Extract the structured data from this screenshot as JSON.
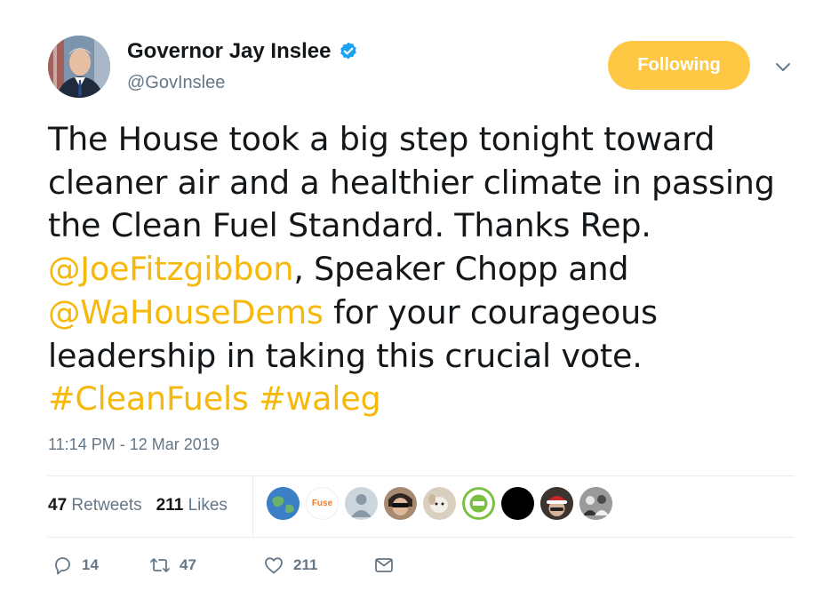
{
  "header": {
    "display_name": "Governor Jay Inslee",
    "handle": "@GovInslee",
    "follow_label": "Following",
    "avatar_icon": "profile-photo-icon",
    "verified_icon": "verified-badge-icon"
  },
  "tweet": {
    "line1": "The House took a big step tonight toward",
    "line2": "cleaner air and a healthier climate in passing",
    "line3": "the Clean Fuel Standard. Thanks Rep.",
    "mention1": "@JoeFitzgibbon",
    "line4_rest": ", Speaker Chopp and",
    "mention2": "@WaHouseDems",
    "line5_rest": " for your courageous",
    "line6": "leadership in taking this crucial vote.",
    "hashtag1": "#CleanFuels",
    "hashtag2": "#waleg",
    "timestamp": "11:14 PM - 12 Mar 2019"
  },
  "stats": {
    "retweets_count": "47",
    "retweets_label": "Retweets",
    "likes_count": "211",
    "likes_label": "Likes",
    "liker_avatars": [
      "globe-avatar-icon",
      "fuse-logo-icon",
      "default-avatar-icon",
      "person-sunglasses-icon",
      "dog-avatar-icon",
      "green-circle-logo-icon",
      "black-avatar-icon",
      "person-santa-hat-icon",
      "group-photo-icon"
    ],
    "fuse_text": "Fuse"
  },
  "actions": {
    "reply_count": "14",
    "retweet_count": "47",
    "like_count": "211",
    "reply_icon": "reply-icon",
    "retweet_icon": "retweet-icon",
    "like_icon": "heart-icon",
    "dm_icon": "envelope-icon"
  },
  "colors": {
    "accent": "#f5b80b",
    "button": "#ffc844",
    "muted": "#657786",
    "text": "#14171a"
  }
}
